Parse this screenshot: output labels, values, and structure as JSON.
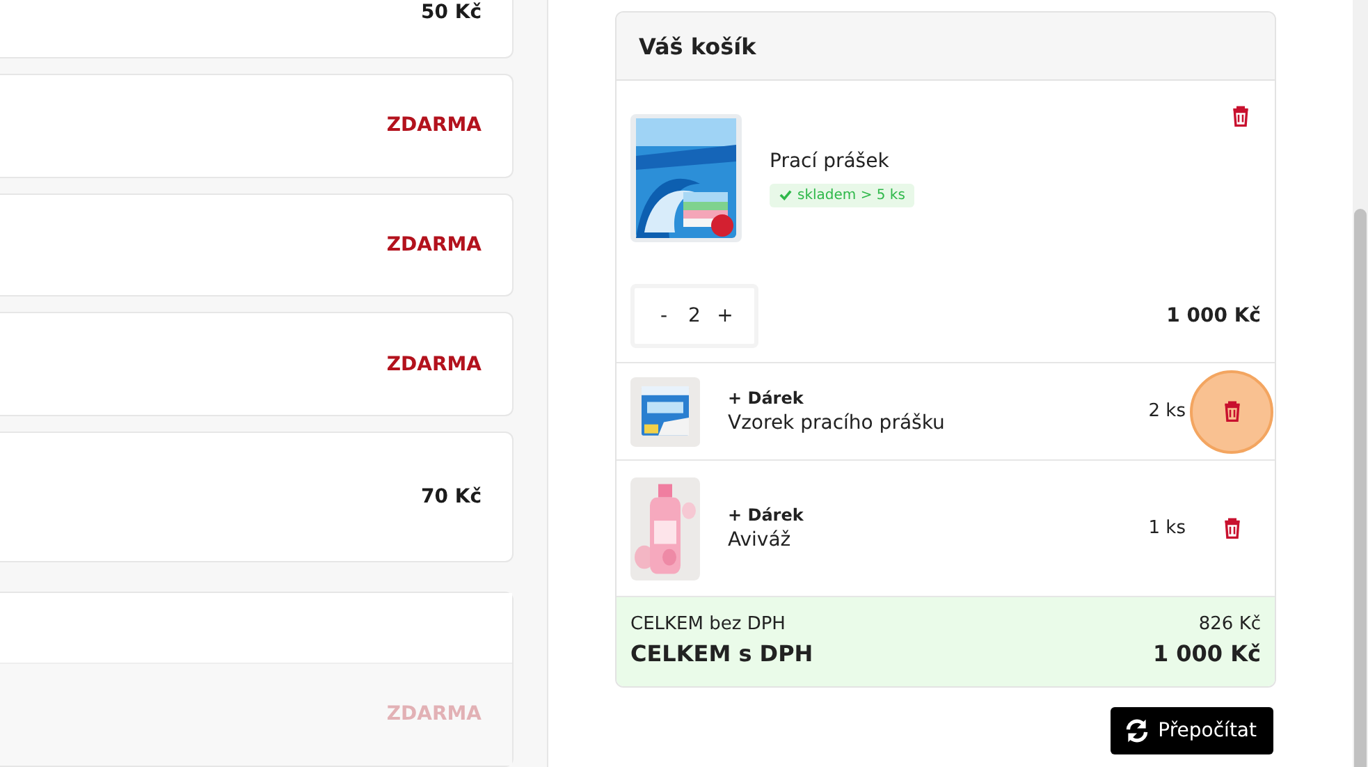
{
  "options": [
    {
      "price": "50 Kč",
      "kind": "paid",
      "disabled": false
    },
    {
      "price": "ZDARMA",
      "kind": "free",
      "disabled": false
    },
    {
      "price": "ZDARMA",
      "kind": "free",
      "disabled": false
    },
    {
      "price": "ZDARMA",
      "kind": "free",
      "disabled": false
    },
    {
      "price": "70 Kč",
      "kind": "paid",
      "disabled": false
    },
    {
      "price": "ZDARMA",
      "kind": "free",
      "disabled": true
    }
  ],
  "cart": {
    "title": "Váš košík",
    "main_item": {
      "name": "Prací prášek",
      "stock": "skladem > 5 ks",
      "minus": "-",
      "quantity": "2",
      "plus": "+",
      "price": "1 000 Kč"
    },
    "gifts": [
      {
        "label": "+ Dárek",
        "name": "Vzorek pracího prášku",
        "quantity": "2 ks",
        "highlighted": true,
        "kind": "sachet"
      },
      {
        "label": "+ Dárek",
        "name": "Aviváž",
        "quantity": "1 ks",
        "highlighted": false,
        "kind": "bottle"
      }
    ],
    "totals": {
      "net_label": "CELKEM bez DPH",
      "net_value": "826 Kč",
      "gross_label": "CELKEM s DPH",
      "gross_value": "1 000 Kč"
    },
    "recalc_button": "Přepočítat"
  }
}
